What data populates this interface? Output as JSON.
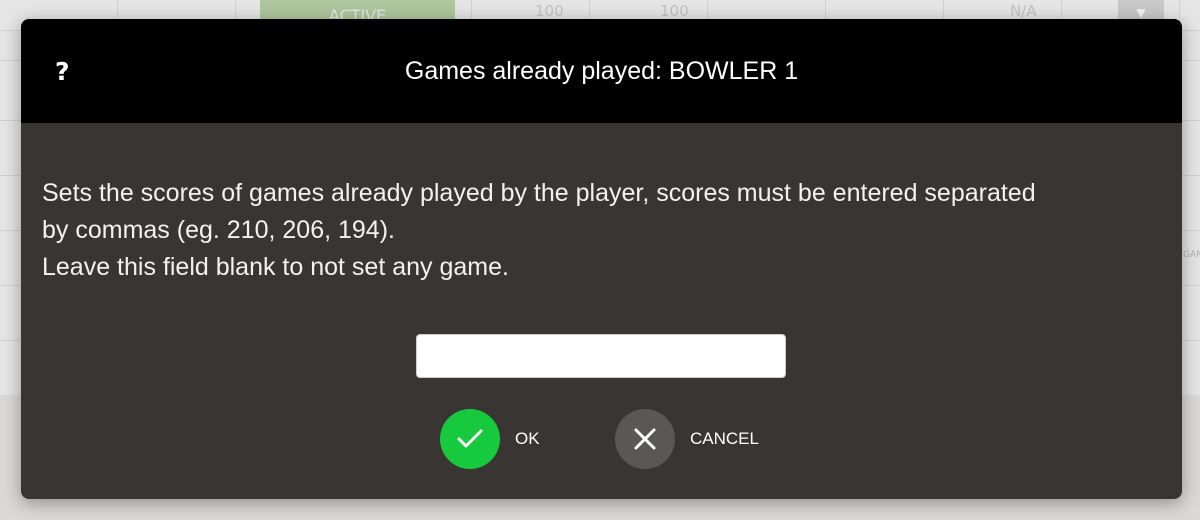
{
  "background": {
    "active_label": "ACTIVE",
    "cell_a": "100",
    "cell_b": "100",
    "cell_c": "N/A",
    "side_label": "GAN",
    "dropdown_glyph": "▼"
  },
  "dialog": {
    "help_symbol": "?",
    "title": "Games already played: BOWLER 1",
    "description_line1": "Sets the scores of games already played by the player, scores must be entered separated",
    "description_line2": "by commas (eg. 210, 206, 194).",
    "description_line3": "Leave this field blank to not set any game.",
    "input_value": "",
    "input_placeholder": "",
    "ok_label": "OK",
    "cancel_label": "CANCEL",
    "ok_icon": "check-icon",
    "cancel_icon": "close-icon",
    "ok_color": "#17c93c",
    "cancel_color": "#5a5756",
    "header_color": "#000000",
    "body_color": "#383532"
  }
}
